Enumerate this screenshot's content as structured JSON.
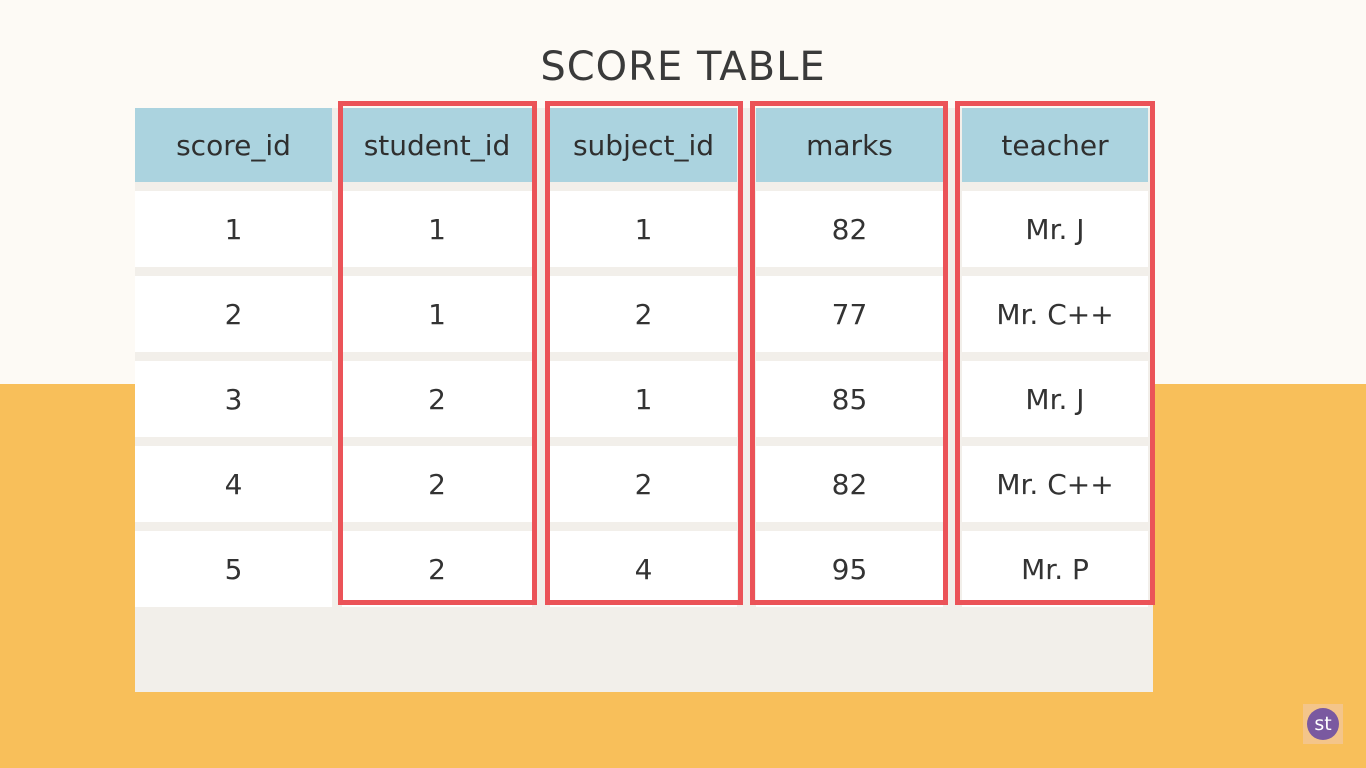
{
  "title": "SCORE TABLE",
  "table": {
    "columns": [
      "score_id",
      "student_id",
      "subject_id",
      "marks",
      "teacher"
    ],
    "rows": [
      [
        "1",
        "1",
        "1",
        "82",
        "Mr. J"
      ],
      [
        "2",
        "1",
        "2",
        "77",
        "Mr. C++"
      ],
      [
        "3",
        "2",
        "1",
        "85",
        "Mr. J"
      ],
      [
        "4",
        "2",
        "2",
        "82",
        "Mr. C++"
      ],
      [
        "5",
        "2",
        "4",
        "95",
        "Mr. P"
      ]
    ],
    "highlighted_columns": [
      "student_id",
      "subject_id",
      "marks",
      "teacher"
    ]
  },
  "colors": {
    "background_top": "#fdfaf5",
    "background_bottom": "#f8bf5a",
    "header": "#abd3df",
    "highlight": "#eb5358",
    "logo": "#7a59a0"
  },
  "logo": {
    "text": "st",
    "icon": "st-logo-icon"
  }
}
